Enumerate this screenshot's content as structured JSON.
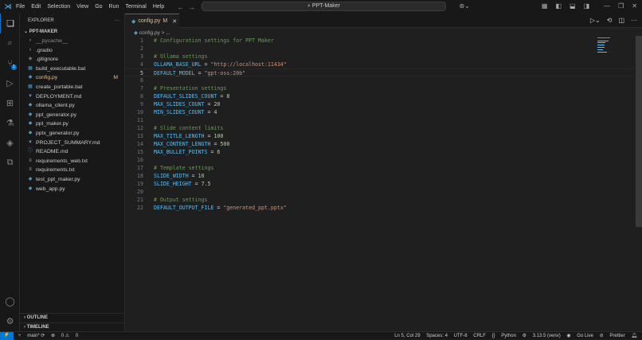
{
  "title_bar": {
    "menu": [
      "File",
      "Edit",
      "Selection",
      "View",
      "Go",
      "Run",
      "Terminal",
      "Help"
    ],
    "search": "PPT-Maker"
  },
  "activity": {
    "scm_badge": "1"
  },
  "sidebar": {
    "title": "EXPLORER",
    "more": "···",
    "project": "PPT-MAKER",
    "files": [
      {
        "name": "__pycache__",
        "icon": "chevron",
        "dim": true
      },
      {
        "name": ".gradio",
        "icon": "chevron"
      },
      {
        "name": ".gitignore",
        "icon": "git"
      },
      {
        "name": "build_executable.bat",
        "icon": "windows"
      },
      {
        "name": "config.py",
        "icon": "python",
        "modified": "M"
      },
      {
        "name": "create_portable.bat",
        "icon": "windows"
      },
      {
        "name": "DEPLOYMENT.md",
        "icon": "markdown"
      },
      {
        "name": "ollama_client.py",
        "icon": "python"
      },
      {
        "name": "ppt_generator.py",
        "icon": "python"
      },
      {
        "name": "ppt_maker.py",
        "icon": "python"
      },
      {
        "name": "pptx_generator.py",
        "icon": "python"
      },
      {
        "name": "PROJECT_SUMMARY.md",
        "icon": "markdown"
      },
      {
        "name": "README.md",
        "icon": "info"
      },
      {
        "name": "requirements_web.txt",
        "icon": "text"
      },
      {
        "name": "requirements.txt",
        "icon": "text"
      },
      {
        "name": "test_ppt_maker.py",
        "icon": "python"
      },
      {
        "name": "web_app.py",
        "icon": "python"
      }
    ],
    "outline": "OUTLINE",
    "timeline": "TIMELINE"
  },
  "tab": {
    "name": "config.py",
    "flag": "M"
  },
  "breadcrumb": "config.py > ...",
  "code": [
    [
      [
        "c",
        "# Configuration settings for PPT Maker"
      ]
    ],
    [],
    [
      [
        "c",
        "# Ollama settings"
      ]
    ],
    [
      [
        "v",
        "OLLAMA_BASE_URL"
      ],
      [
        "o",
        " = "
      ],
      [
        "s",
        "\"http://localhost:11434\""
      ]
    ],
    [
      [
        "v",
        "DEFAULT_MODEL"
      ],
      [
        "o",
        " = "
      ],
      [
        "s",
        "\"gpt-oss:20b\""
      ]
    ],
    [],
    [
      [
        "c",
        "# Presentation settings"
      ]
    ],
    [
      [
        "v",
        "DEFAULT_SLIDES_COUNT"
      ],
      [
        "o",
        " = "
      ],
      [
        "n",
        "8"
      ]
    ],
    [
      [
        "v",
        "MAX_SLIDES_COUNT"
      ],
      [
        "o",
        " = "
      ],
      [
        "n",
        "20"
      ]
    ],
    [
      [
        "v",
        "MIN_SLIDES_COUNT"
      ],
      [
        "o",
        " = "
      ],
      [
        "n",
        "4"
      ]
    ],
    [],
    [
      [
        "c",
        "# Slide content limits"
      ]
    ],
    [
      [
        "v",
        "MAX_TITLE_LENGTH"
      ],
      [
        "o",
        " = "
      ],
      [
        "n",
        "100"
      ]
    ],
    [
      [
        "v",
        "MAX_CONTENT_LENGTH"
      ],
      [
        "o",
        " = "
      ],
      [
        "n",
        "500"
      ]
    ],
    [
      [
        "v",
        "MAX_BULLET_POINTS"
      ],
      [
        "o",
        " = "
      ],
      [
        "n",
        "6"
      ]
    ],
    [],
    [
      [
        "c",
        "# Template settings"
      ]
    ],
    [
      [
        "v",
        "SLIDE_WIDTH"
      ],
      [
        "o",
        " = "
      ],
      [
        "n",
        "10"
      ]
    ],
    [
      [
        "v",
        "SLIDE_HEIGHT"
      ],
      [
        "o",
        " = "
      ],
      [
        "n",
        "7.5"
      ]
    ],
    [],
    [
      [
        "c",
        "# Output settings"
      ]
    ],
    [
      [
        "v",
        "DEFAULT_OUTPUT_FILE"
      ],
      [
        "o",
        " = "
      ],
      [
        "s",
        "\"generated_ppt.pptx\""
      ]
    ]
  ],
  "current_line": 5,
  "status": {
    "branch": "main*",
    "errors": "0",
    "warnings": "0",
    "position": "Ln 5, Col 29",
    "spaces": "Spaces: 4",
    "encoding": "UTF-8",
    "eol": "CRLF",
    "language": "Python",
    "interpreter": "3.13.5 (venv)",
    "golive": "Go Live",
    "prettier": "Prettier"
  }
}
